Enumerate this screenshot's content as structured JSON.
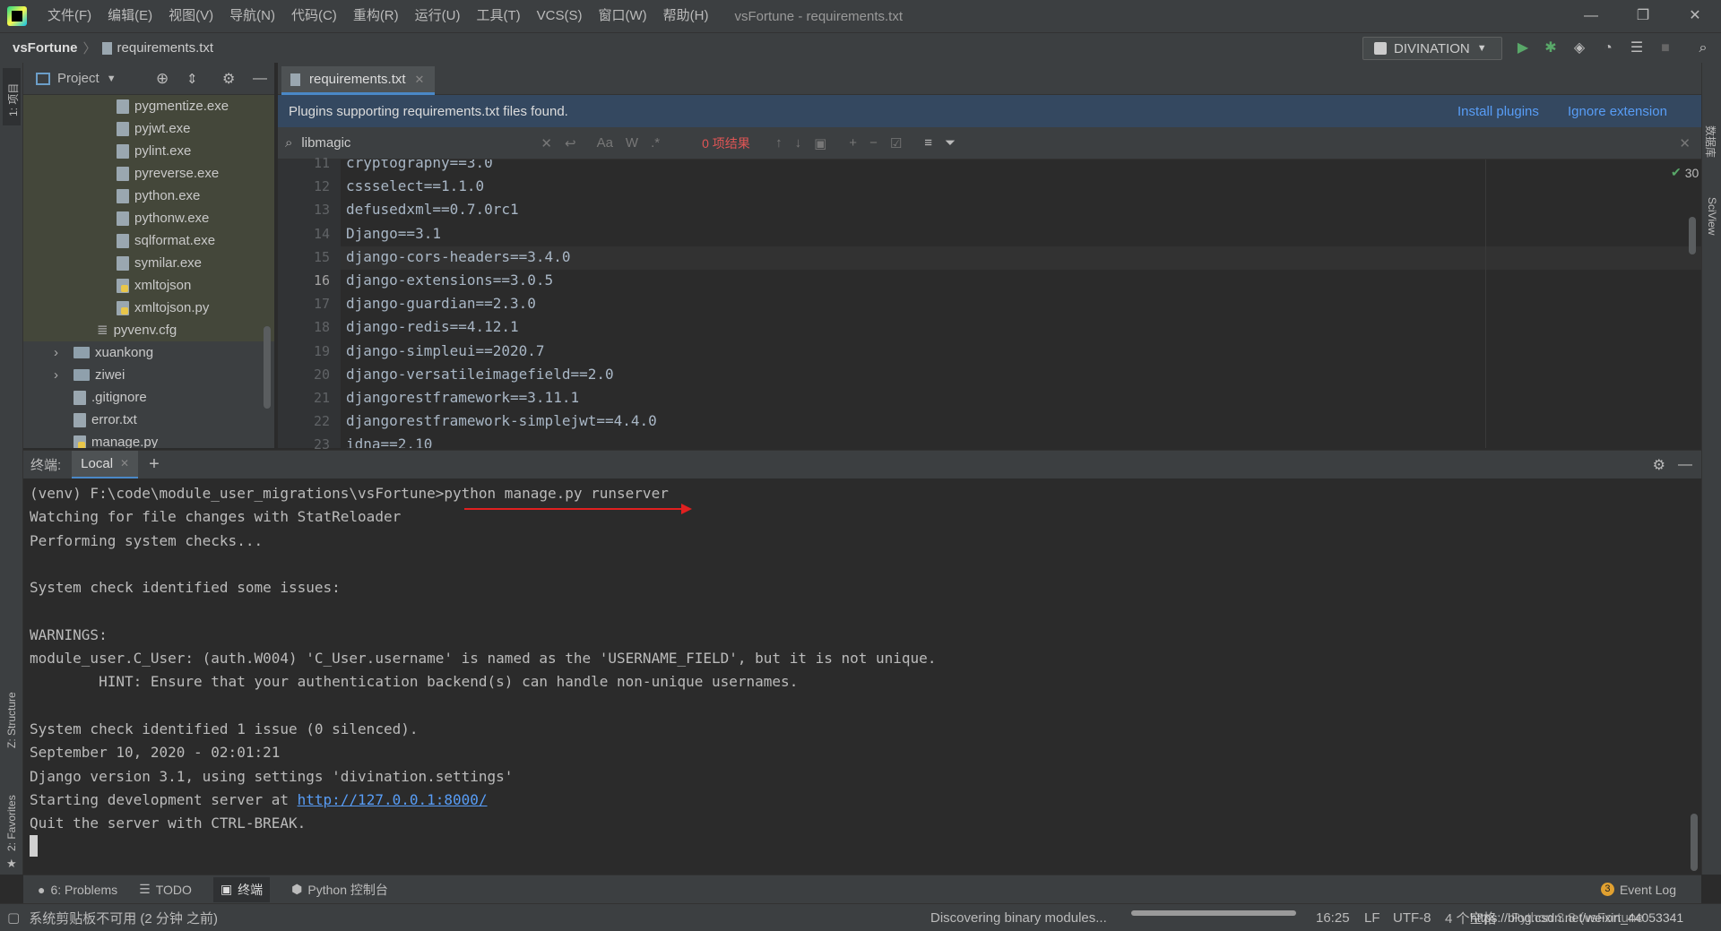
{
  "titlebar": {
    "menus": [
      "文件(F)",
      "编辑(E)",
      "视图(V)",
      "导航(N)",
      "代码(C)",
      "重构(R)",
      "运行(U)",
      "工具(T)",
      "VCS(S)",
      "窗口(W)",
      "帮助(H)"
    ],
    "window_title": "vsFortune - requirements.txt",
    "controls": [
      "—",
      "❐",
      "✕"
    ]
  },
  "navbar": {
    "project": "vsFortune",
    "file": "requirements.txt",
    "run_config": "DIVINATION"
  },
  "left_strip": {
    "project_label": "1: 项目",
    "structure_label": "Z: Structure",
    "favorites_label": "2: Favorites"
  },
  "right_strip": {
    "db_label": "数据库",
    "sciview_label": "SciView"
  },
  "project_pane": {
    "title": "Project",
    "items": [
      {
        "name": "pygmentize.exe",
        "kind": "file"
      },
      {
        "name": "pyjwt.exe",
        "kind": "file"
      },
      {
        "name": "pylint.exe",
        "kind": "file"
      },
      {
        "name": "pyreverse.exe",
        "kind": "file"
      },
      {
        "name": "python.exe",
        "kind": "file"
      },
      {
        "name": "pythonw.exe",
        "kind": "file"
      },
      {
        "name": "sqlformat.exe",
        "kind": "file"
      },
      {
        "name": "symilar.exe",
        "kind": "file"
      },
      {
        "name": "xmltojson",
        "kind": "py"
      },
      {
        "name": "xmltojson.py",
        "kind": "py"
      },
      {
        "name": "pyvenv.cfg",
        "kind": "cfg"
      },
      {
        "name": "xuankong",
        "kind": "folder"
      },
      {
        "name": "ziwei",
        "kind": "folder"
      },
      {
        "name": ".gitignore",
        "kind": "file"
      },
      {
        "name": "error.txt",
        "kind": "file"
      },
      {
        "name": "manage.py",
        "kind": "py"
      }
    ]
  },
  "editor": {
    "tab": "requirements.txt",
    "banner": {
      "message": "Plugins supporting requirements.txt files found.",
      "install": "Install plugins",
      "ignore": "Ignore extension"
    },
    "search": {
      "query": "libmagic",
      "case_label": "Aa",
      "word_label": "W",
      "regex_label": ".*",
      "results": "0 项结果"
    },
    "inspection_count": "30",
    "current_line": 16,
    "lines": [
      {
        "num": "11",
        "text": "cryptography==3.0"
      },
      {
        "num": "12",
        "text": "cssselect==1.1.0"
      },
      {
        "num": "13",
        "text": "defusedxml==0.7.0rc1"
      },
      {
        "num": "14",
        "text": "Django==3.1"
      },
      {
        "num": "15",
        "text": "django-cors-headers==3.4.0"
      },
      {
        "num": "16",
        "text": "django-extensions==3.0.5"
      },
      {
        "num": "17",
        "text": "django-guardian==2.3.0"
      },
      {
        "num": "18",
        "text": "django-redis==4.12.1"
      },
      {
        "num": "19",
        "text": "django-simpleui==2020.7"
      },
      {
        "num": "20",
        "text": "django-versatileimagefield==2.0"
      },
      {
        "num": "21",
        "text": "djangorestframework==3.11.1"
      },
      {
        "num": "22",
        "text": "djangorestframework-simplejwt==4.4.0"
      },
      {
        "num": "23",
        "text": "idna==2.10"
      }
    ]
  },
  "terminal": {
    "label": "终端:",
    "tab": "Local",
    "add": "+",
    "lines": [
      "(venv) F:\\code\\module_user_migrations\\vsFortune>python manage.py runserver",
      "Watching for file changes with StatReloader",
      "Performing system checks...",
      "",
      "System check identified some issues:",
      "",
      "WARNINGS:",
      "module_user.C_User: (auth.W004) 'C_User.username' is named as the 'USERNAME_FIELD', but it is not unique.",
      "        HINT: Ensure that your authentication backend(s) can handle non-unique usernames.",
      "",
      "System check identified 1 issue (0 silenced).",
      "September 10, 2020 - 02:01:21",
      "Django version 3.1, using settings 'divination.settings'"
    ],
    "server_prefix": "Starting development server at ",
    "server_url": "http://127.0.0.1:8000/",
    "quit_line": "Quit the server with CTRL-BREAK.",
    "arrow_color": "#e02020"
  },
  "tool_buttons": {
    "problems": "6: Problems",
    "todo": "TODO",
    "terminal": "终端",
    "python_console": "Python 控制台",
    "event_log": "Event Log",
    "event_count": "3"
  },
  "statusbar": {
    "message": "系统剪贴板不可用 (2 分钟 之前)",
    "task": "Discovering binary modules...",
    "progress": 1.0,
    "position": "16:25",
    "line_sep": "LF",
    "encoding": "UTF-8",
    "indent": "4 个空格",
    "interpreter": "Python 3.8 (vsFortune",
    "watermark": "https://blog.csdn.net/weixin_44053341"
  }
}
